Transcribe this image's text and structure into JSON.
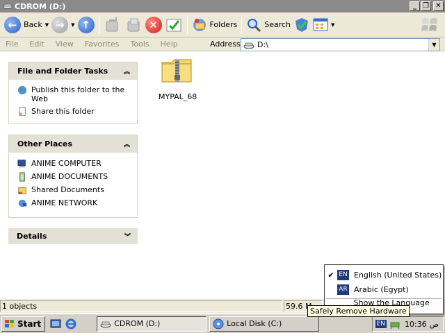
{
  "window": {
    "title": "CDROM (D:)"
  },
  "toolbar": {
    "back_label": "Back",
    "folders_label": "Folders",
    "search_label": "Search"
  },
  "menubar": {
    "items": [
      "File",
      "Edit",
      "View",
      "Favorites",
      "Tools",
      "Help"
    ]
  },
  "address": {
    "label": "Address",
    "value": "D:\\"
  },
  "tasks_panel": {
    "title": "File and Folder Tasks",
    "items": [
      {
        "label": "Publish this folder to the Web",
        "icon": "globe-icon"
      },
      {
        "label": "Share this folder",
        "icon": "share-icon"
      }
    ]
  },
  "places_panel": {
    "title": "Other Places",
    "items": [
      {
        "label": "ANIME COMPUTER",
        "icon": "computer-icon"
      },
      {
        "label": "ANIME DOCUMENTS",
        "icon": "documents-icon"
      },
      {
        "label": "Shared Documents",
        "icon": "shared-documents-icon"
      },
      {
        "label": "ANIME NETWORK",
        "icon": "network-icon"
      }
    ]
  },
  "details_panel": {
    "title": "Details"
  },
  "files": [
    {
      "name": "MYPAL_68",
      "icon": "zip-folder-icon"
    }
  ],
  "statusbar": {
    "count": "1 objects",
    "size": "59.6 M"
  },
  "taskbar": {
    "start_label": "Start",
    "buttons": [
      {
        "label": "CDROM (D:)",
        "icon": "cdrom-icon"
      },
      {
        "label": "Local Disk (C:)",
        "icon": "disk-icon"
      }
    ],
    "lang_indicator": "EN",
    "clock": "10:36",
    "ampm": "ص"
  },
  "language_menu": {
    "items": [
      {
        "badge": "EN",
        "label": "English (United States)",
        "checked": true
      },
      {
        "badge": "AR",
        "label": "Arabic (Egypt)",
        "checked": false
      }
    ],
    "partial_item": "Show the Language bar"
  },
  "tooltip": "Safely Remove Hardware",
  "colors": {
    "titlebar": "#8a8a8a",
    "panel_header": "#e3e1d6",
    "lang_badge": "#203a7a",
    "tooltip_bg": "#ffffe1"
  }
}
